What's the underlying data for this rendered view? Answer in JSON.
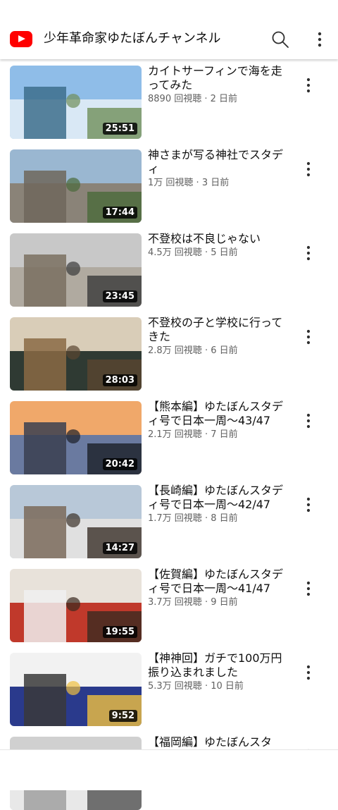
{
  "header": {
    "channel_title": "少年革命家ゆたぼんチャンネル"
  },
  "icons": {
    "logo": "youtube-logo-icon",
    "search": "search-icon",
    "more": "more-vertical-icon"
  },
  "videos": [
    {
      "title": "カイトサーフィンで海を走ってみた",
      "views": "8890 回視聴",
      "age": "2 日前",
      "duration": "25:51"
    },
    {
      "title": "神さまが写る神社でスタディ",
      "views": "1万 回視聴",
      "age": "3 日前",
      "duration": "17:44"
    },
    {
      "title": "不登校は不良じゃない",
      "views": "4.5万 回視聴",
      "age": "5 日前",
      "duration": "23:45"
    },
    {
      "title": "不登校の子と学校に行ってきた",
      "views": "2.8万 回視聴",
      "age": "6 日前",
      "duration": "28:03"
    },
    {
      "title": "【熊本編】ゆたぼんスタディ号で日本一周〜43/47",
      "views": "2.1万 回視聴",
      "age": "7 日前",
      "duration": "20:42"
    },
    {
      "title": "【長崎編】ゆたぼんスタディ号で日本一周〜42/47",
      "views": "1.7万 回視聴",
      "age": "8 日前",
      "duration": "14:27"
    },
    {
      "title": "【佐賀編】ゆたぼんスタディ号で日本一周〜41/47",
      "views": "3.7万 回視聴",
      "age": "9 日前",
      "duration": "19:55"
    },
    {
      "title": "【神神回】ガチで100万円振り込まれました",
      "views": "5.3万 回視聴",
      "age": "10 日前",
      "duration": "9:52"
    },
    {
      "title": "【福岡編】ゆたぼんスタ",
      "views": "",
      "age": "",
      "duration": ""
    }
  ],
  "separator": " · "
}
